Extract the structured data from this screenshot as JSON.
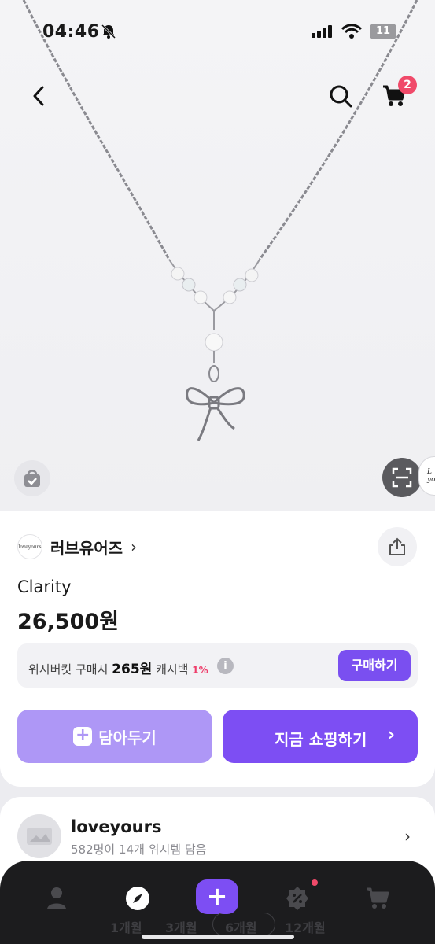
{
  "status_bar": {
    "time": "04:46",
    "battery": "11"
  },
  "header": {
    "cart_count": "2"
  },
  "image_overlay": {
    "signature_text": "Love yours"
  },
  "brand": {
    "logo_text": "loveyours",
    "name": "러브유어즈",
    "chevron": "›"
  },
  "product": {
    "name": "Clarity",
    "price": "26,500원"
  },
  "cashback": {
    "prefix": "위시버킷 구매시",
    "amount": "265원",
    "suffix": "캐시백",
    "percent": "1%",
    "info_label": "i",
    "buy_label": "구매하기"
  },
  "actions": {
    "save_label": "담아두기",
    "save_plus": "+",
    "shop_label": "지금 쇼핑하기",
    "shop_chevron": "›"
  },
  "seller": {
    "name": "loveyours",
    "subtitle": "582명이 14개 위시템 담음",
    "chevron": "›"
  },
  "tabbar": {
    "plus_label": "+",
    "periods": [
      "1개월",
      "3개월",
      "6개월",
      "12개월"
    ]
  },
  "colors": {
    "accent": "#7d4ef3",
    "accent_light": "#ae97f6",
    "badge": "#f04a6a",
    "cashback_pct": "#ee3d6a"
  },
  "icons": [
    "back-arrow-icon",
    "search-icon",
    "cart-icon",
    "shopping-bag-check-icon",
    "scan-icon",
    "share-icon",
    "person-icon",
    "compass-icon",
    "percent-tag-icon",
    "cart-icon"
  ]
}
